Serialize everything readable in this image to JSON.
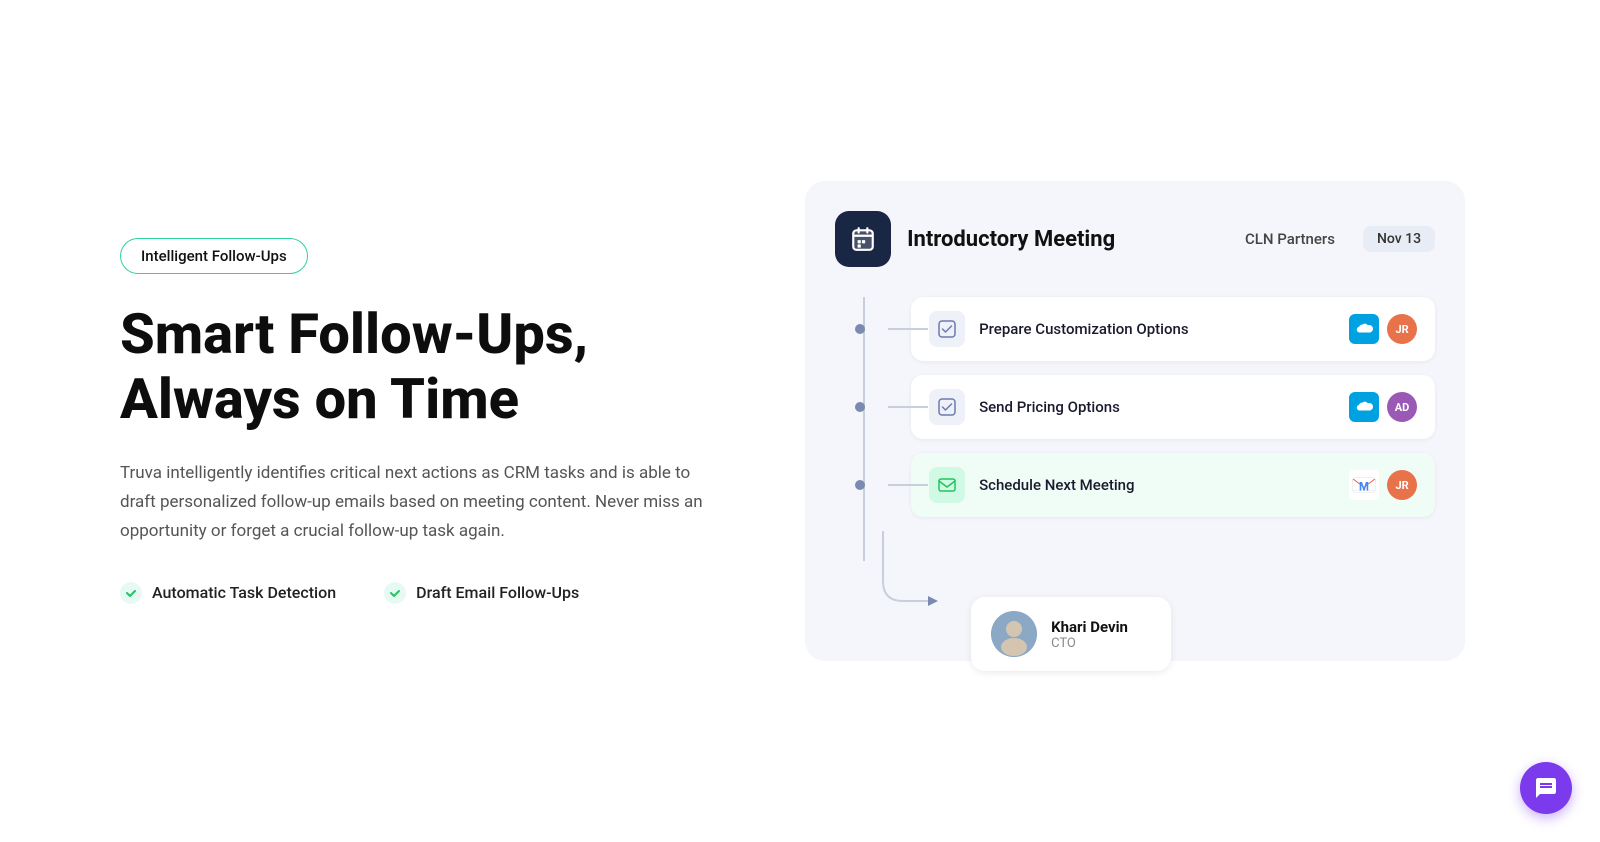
{
  "badge": {
    "label": "Intelligent Follow-Ups"
  },
  "headline": {
    "line1": "Smart Follow-Ups,",
    "line2": "Always on Time"
  },
  "description": "Truva intelligently identifies critical next actions as CRM tasks and is able to draft personalized follow-up emails based on meeting content. Never miss an opportunity or forget a crucial follow-up task again.",
  "features": [
    {
      "label": "Automatic Task Detection"
    },
    {
      "label": "Draft Email Follow-Ups"
    }
  ],
  "meeting": {
    "title": "Introductory Meeting",
    "company": "CLN Partners",
    "date": "Nov 13"
  },
  "tasks": [
    {
      "label": "Prepare Customization Options",
      "type": "checkbox",
      "variant": "default",
      "avatarInitials": "JR",
      "avatarClass": "avatar-jr",
      "hasSalesforce": true
    },
    {
      "label": "Send Pricing Options",
      "type": "checkbox",
      "variant": "default",
      "avatarInitials": "AD",
      "avatarClass": "avatar-ad",
      "hasSalesforce": true
    },
    {
      "label": "Schedule Next Meeting",
      "type": "email",
      "variant": "green",
      "avatarInitials": "JR",
      "avatarClass": "avatar-jr",
      "hasGmail": true
    }
  ],
  "contact": {
    "name": "Khari Devin",
    "title": "CTO"
  },
  "chat": {
    "ariaLabel": "Open chat"
  }
}
